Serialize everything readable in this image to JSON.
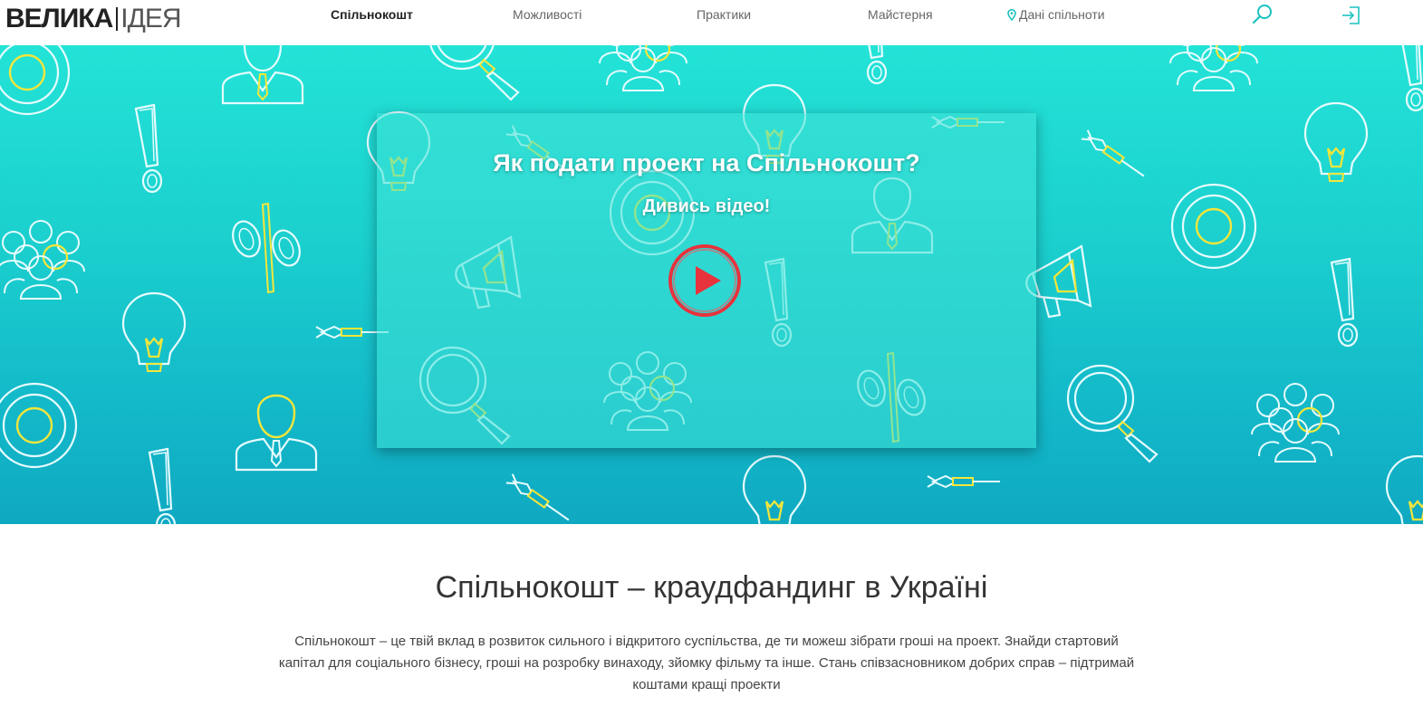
{
  "header": {
    "logo_bold": "ВЕЛИКА",
    "logo_light": "ІДЕЯ",
    "nav": [
      {
        "label": "Спільнокошт",
        "active": true
      },
      {
        "label": "Можливості",
        "active": false
      },
      {
        "label": "Практики",
        "active": false
      },
      {
        "label": "Майстерня",
        "active": false
      },
      {
        "label": "Дані спільноти",
        "active": false,
        "icon": "map-pin-icon"
      }
    ],
    "icons": [
      "search-icon",
      "login-icon"
    ],
    "accent_color": "#1cc2c0"
  },
  "hero": {
    "video_title": "Як подати проект на Спільнокошт?",
    "video_subtitle": "Дивись відео!",
    "play_icon": "play-icon",
    "play_color": "#e8323c",
    "pattern_icons": [
      "lightbulb-icon",
      "exclamation-icon",
      "percent-icon",
      "target-icon",
      "dart-icon",
      "magnifier-icon",
      "people-icon",
      "person-icon",
      "megaphone-icon"
    ],
    "colors": {
      "bg_top": "#23e3d7",
      "bg_bottom": "#0fa9c2",
      "stroke": "#e6fbff",
      "highlight": "#f5e63a"
    }
  },
  "content": {
    "title": "Спільнокошт – краудфандинг в Україні",
    "description": "Спільнокошт – це твій вклад в розвиток сильного і відкритого суспільства, де ти можеш зібрати гроші на проект. Знайди стартовий капітал для соціального бізнесу, гроші на розробку винаходу, зйомку фільму та інше. Стань співзасновником добрих справ – підтримай коштами кращі проекти"
  }
}
